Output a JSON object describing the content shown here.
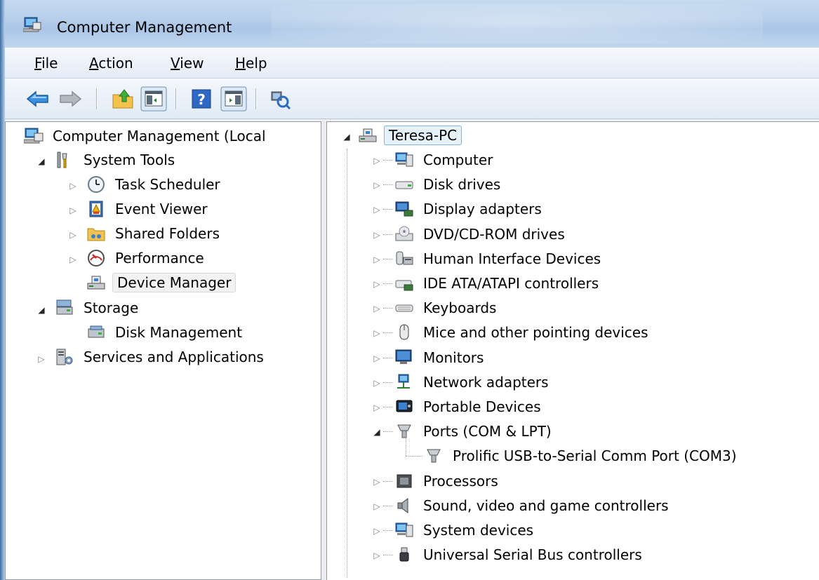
{
  "window": {
    "title": "Computer Management"
  },
  "menu": [
    {
      "accel": "F",
      "rest": "ile"
    },
    {
      "accel": "A",
      "rest": "ction"
    },
    {
      "accel": "V",
      "rest": "iew"
    },
    {
      "accel": "H",
      "rest": "elp"
    }
  ],
  "toolbar": {
    "buttons": [
      "back-icon",
      "forward-icon",
      "up-folder-icon",
      "show-hide-console-tree-icon",
      "help-icon",
      "show-hide-action-pane-icon",
      "scan-hardware-icon"
    ]
  },
  "tree": {
    "root": "Computer Management (Local",
    "system_tools": "System Tools",
    "task_scheduler": "Task Scheduler",
    "event_viewer": "Event Viewer",
    "shared_folders": "Shared Folders",
    "performance": "Performance",
    "device_manager": "Device Manager",
    "storage": "Storage",
    "disk_management": "Disk Management",
    "services_apps": "Services and Applications"
  },
  "devices": {
    "root": "Teresa-PC",
    "categories": [
      "Computer",
      "Disk drives",
      "Display adapters",
      "DVD/CD-ROM drives",
      "Human Interface Devices",
      "IDE ATA/ATAPI controllers",
      "Keyboards",
      "Mice and other pointing devices",
      "Monitors",
      "Network adapters",
      "Portable Devices",
      "Ports (COM & LPT)",
      "Prolific USB-to-Serial Comm Port (COM3)",
      "Processors",
      "Sound, video and game controllers",
      "System devices",
      "Universal Serial Bus controllers"
    ]
  },
  "colors": {
    "accent": "#3c7fb1",
    "selection_focus": "#7db4e3"
  }
}
